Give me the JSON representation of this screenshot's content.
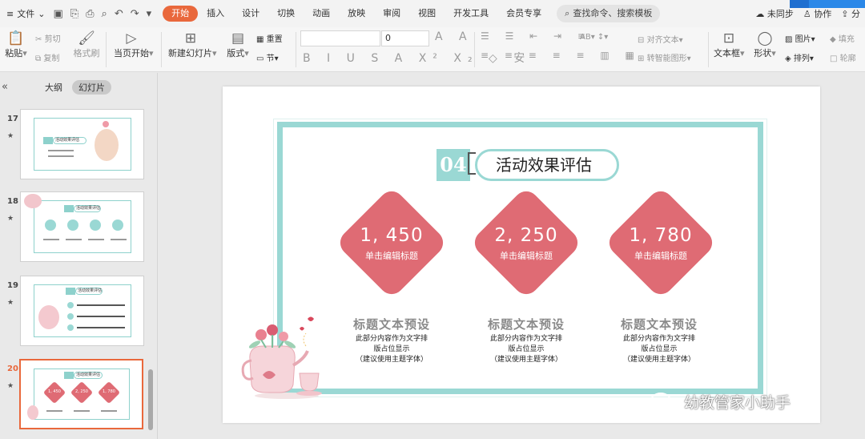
{
  "menu": {
    "file_label": "文件",
    "tabs": [
      "开始",
      "插入",
      "设计",
      "切换",
      "动画",
      "放映",
      "审阅",
      "视图",
      "开发工具",
      "会员专享"
    ],
    "active_tab": "开始",
    "search_placeholder": "查找命令、搜索模板",
    "right": {
      "sync": "未同步",
      "collab": "协作",
      "share": "分"
    }
  },
  "ribbon": {
    "paste": "粘贴",
    "cut": "剪切",
    "copy": "复制",
    "format_painter": "格式刷",
    "from_current": "当页开始",
    "new_slide": "新建幻灯片",
    "layout": "版式",
    "section": "节",
    "reset": "重置",
    "font_size": "0",
    "align_text": "对齐文本",
    "to_smartart": "转智能图形",
    "textbox": "文本框",
    "shape": "形状",
    "picture": "图片",
    "arrange": "排列",
    "fill": "填充",
    "outline": "轮廓"
  },
  "left_panel": {
    "tabs": [
      "大纲",
      "幻灯片"
    ],
    "active_tab": "幻灯片",
    "thumbnails": [
      {
        "number": "17",
        "title": "活动效果评估"
      },
      {
        "number": "18",
        "title": "活动效果评估"
      },
      {
        "number": "19",
        "title": "活动效果评估"
      },
      {
        "number": "20",
        "title": "活动效果评估",
        "values": [
          "1, 450",
          "2, 250",
          "1, 780"
        ]
      }
    ],
    "current": "20"
  },
  "slide": {
    "badge": "04",
    "title": "活动效果评估",
    "metrics": [
      {
        "value": "1, 450",
        "label": "单击编辑标题"
      },
      {
        "value": "2, 250",
        "label": "单击编辑标题"
      },
      {
        "value": "1, 780",
        "label": "单击编辑标题"
      }
    ],
    "columns": [
      {
        "title": "标题文本预设",
        "line1": "此部分内容作为文字排",
        "line2": "版占位显示",
        "line3": "（建议使用主题字体）"
      },
      {
        "title": "标题文本预设",
        "line1": "此部分内容作为文字排",
        "line2": "版占位显示",
        "line3": "（建议使用主题字体）"
      },
      {
        "title": "标题文本预设",
        "line1": "此部分内容作为文字排",
        "line2": "版占位显示",
        "line3": "（建议使用主题字体）"
      }
    ],
    "accent_color": "#9ad8d4",
    "diamond_color": "#df6b74"
  },
  "watermark": "幼教管家小助手"
}
